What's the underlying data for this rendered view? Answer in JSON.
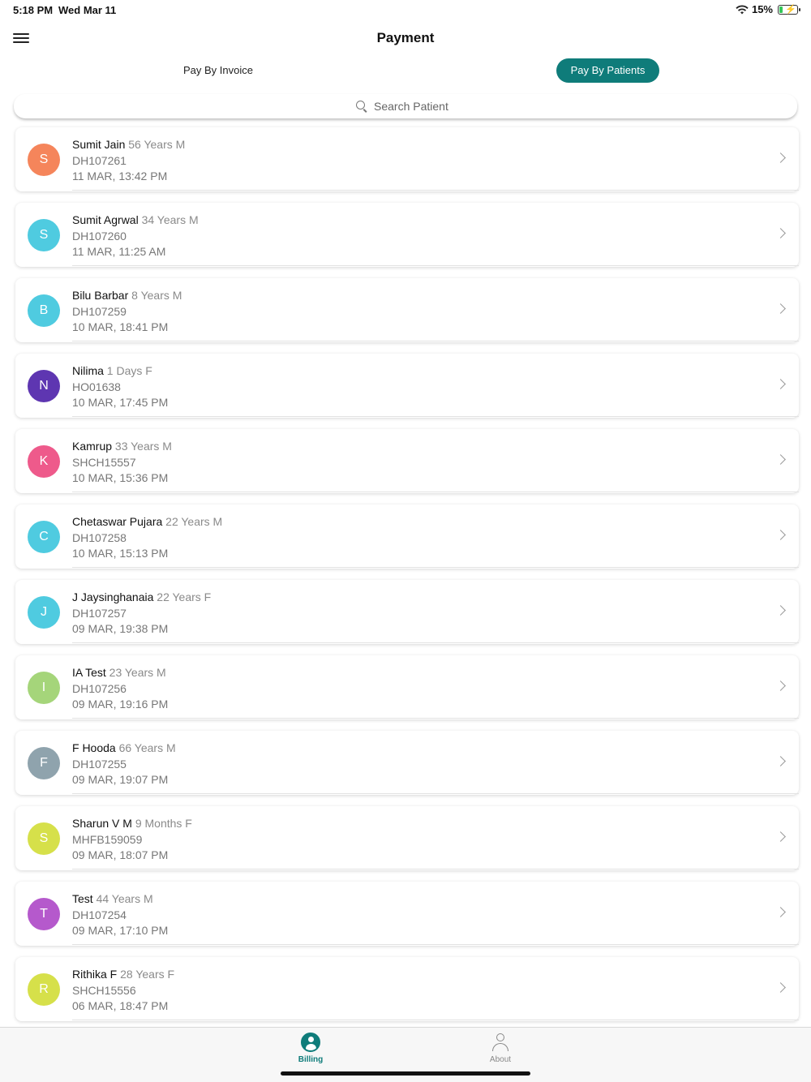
{
  "status": {
    "time": "5:18 PM",
    "date": "Wed Mar 11",
    "battery": "15%"
  },
  "header": {
    "title": "Payment"
  },
  "tabs": {
    "invoice": "Pay By Invoice",
    "patients": "Pay By Patients"
  },
  "search": {
    "placeholder": "Search Patient"
  },
  "patients": [
    {
      "initial": "S",
      "name": "Sumit Jain",
      "meta": "56 Years M",
      "id": "DH107261",
      "datetime": "11 MAR, 13:42 PM",
      "color": "#f5855b"
    },
    {
      "initial": "S",
      "name": "Sumit Agrwal",
      "meta": "34 Years M",
      "id": "DH107260",
      "datetime": "11 MAR, 11:25 AM",
      "color": "#4fcbe0"
    },
    {
      "initial": "B",
      "name": "Bilu Barbar",
      "meta": "8 Years M",
      "id": "DH107259",
      "datetime": "10 MAR, 18:41 PM",
      "color": "#4fcbe0"
    },
    {
      "initial": "N",
      "name": "Nilima",
      "meta": "1 Days F",
      "id": "HO01638",
      "datetime": "10 MAR, 17:45 PM",
      "color": "#5e36b1"
    },
    {
      "initial": "K",
      "name": "Kamrup",
      "meta": "33 Years M",
      "id": "SHCH15557",
      "datetime": "10 MAR, 15:36 PM",
      "color": "#ee5a8b"
    },
    {
      "initial": "C",
      "name": "Chetaswar Pujara",
      "meta": "22 Years M",
      "id": "DH107258",
      "datetime": "10 MAR, 15:13 PM",
      "color": "#4fcbe0"
    },
    {
      "initial": "J",
      "name": "J Jaysinghanaia",
      "meta": "22 Years F",
      "id": "DH107257",
      "datetime": "09 MAR, 19:38 PM",
      "color": "#4fcbe0"
    },
    {
      "initial": "I",
      "name": "IA Test",
      "meta": "23 Years M",
      "id": "DH107256",
      "datetime": "09 MAR, 19:16 PM",
      "color": "#a5d57a"
    },
    {
      "initial": "F",
      "name": "F Hooda",
      "meta": "66 Years M",
      "id": "DH107255",
      "datetime": "09 MAR, 19:07 PM",
      "color": "#8fa3ad"
    },
    {
      "initial": "S",
      "name": "Sharun V M",
      "meta": "9 Months F",
      "id": "MHFB159059",
      "datetime": "09 MAR, 18:07 PM",
      "color": "#d6e04a"
    },
    {
      "initial": "T",
      "name": "Test",
      "meta": "44 Years M",
      "id": "DH107254",
      "datetime": "09 MAR, 17:10 PM",
      "color": "#b559cc"
    },
    {
      "initial": "R",
      "name": "Rithika F",
      "meta": "28 Years F",
      "id": "SHCH15556",
      "datetime": "06 MAR, 18:47 PM",
      "color": "#d6e04a"
    }
  ],
  "tabbar": {
    "billing": "Billing",
    "about": "About"
  },
  "colors": {
    "accent": "#0f7c7a"
  }
}
